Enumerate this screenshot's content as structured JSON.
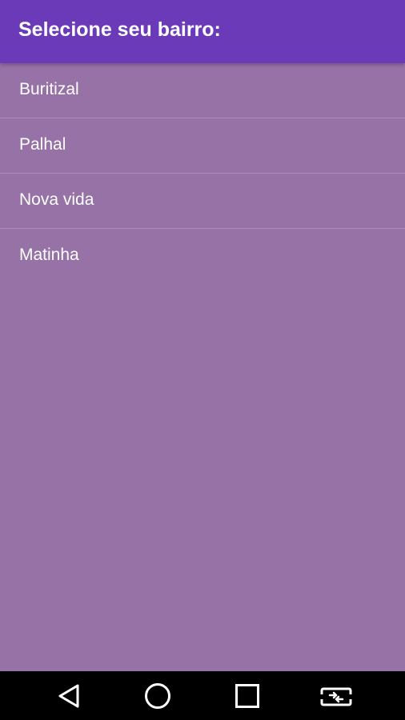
{
  "app_bar": {
    "title": "Selecione seu bairro:",
    "background": "#6a3ab8"
  },
  "list": {
    "background": "#9672a6",
    "items": [
      {
        "label": "Buritizal"
      },
      {
        "label": "Palhal"
      },
      {
        "label": "Nova vida"
      },
      {
        "label": "Matinha"
      }
    ]
  },
  "nav_bar": {
    "buttons": [
      {
        "icon": "back-triangle-icon"
      },
      {
        "icon": "home-circle-icon"
      },
      {
        "icon": "recents-square-icon"
      },
      {
        "icon": "rotate-screen-icon"
      }
    ]
  }
}
